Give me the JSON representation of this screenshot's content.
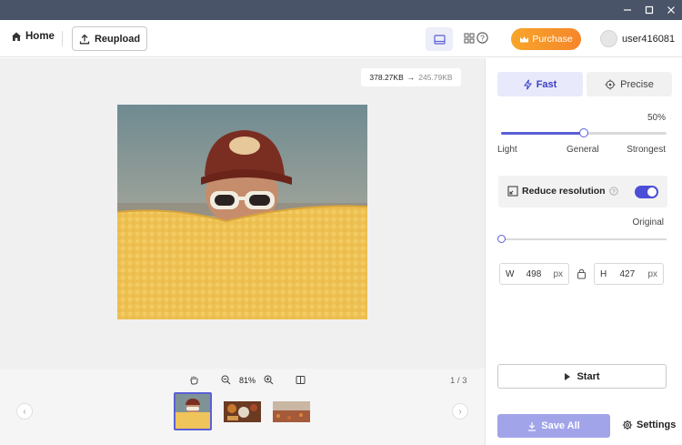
{
  "window": {
    "minimize_icon": "minimize-icon",
    "maximize_icon": "maximize-icon",
    "close_icon": "close-icon"
  },
  "header": {
    "home_label": "Home",
    "reupload_label": "Reupload",
    "purchase_label": "Purchase",
    "username": "user416081",
    "help_glyph": "?"
  },
  "canvas": {
    "original_size": "378.27KB",
    "arrow": "→",
    "compressed_size": "245.79KB"
  },
  "toolbar": {
    "zoom": "81%",
    "page": "1 / 3"
  },
  "panel": {
    "mode_fast": "Fast",
    "mode_precise": "Precise",
    "selected_mode": "Fast",
    "quality_percent": "50%",
    "quality_value": 0.5,
    "label_light": "Light",
    "label_general": "General",
    "label_strongest": "Strongest",
    "reduce_resolution_label": "Reduce resolution",
    "reduce_resolution_on": true,
    "resolution_label": "Original",
    "resolution_value": 0,
    "width_label": "W",
    "width_value": "498",
    "height_label": "H",
    "height_value": "427",
    "unit": "px",
    "start_label": "Start",
    "save_all_label": "Save All",
    "settings_label": "Settings"
  },
  "colors": {
    "accent": "#5b5fd6",
    "purchase": "#f6932a",
    "titlebar": "#4a5468"
  }
}
